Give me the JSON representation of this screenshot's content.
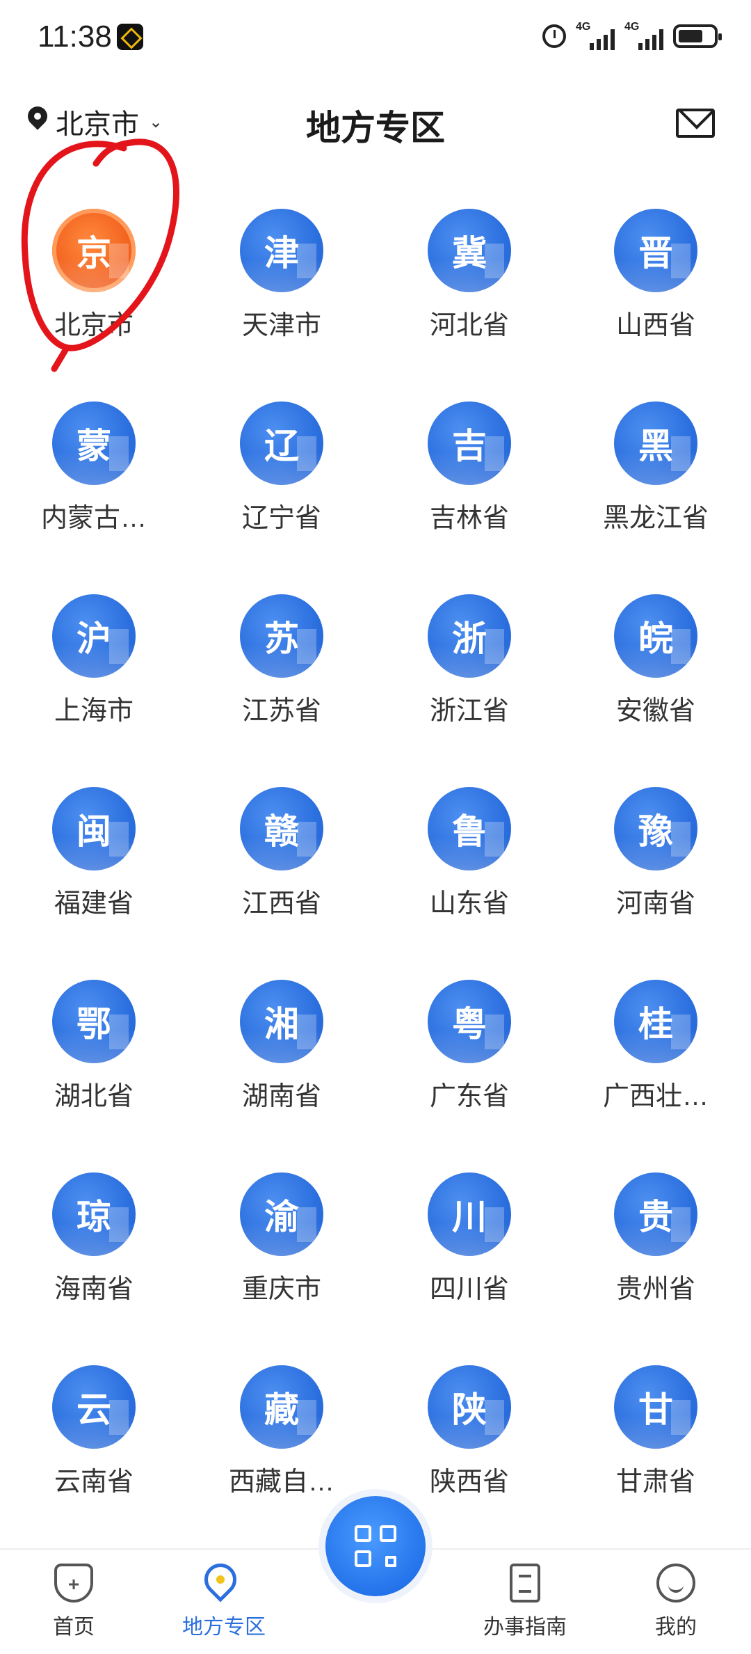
{
  "status_bar": {
    "time": "11:38",
    "network": "4G"
  },
  "header": {
    "location": "北京市",
    "title": "地方专区"
  },
  "regions": [
    {
      "glyph": "京",
      "label": "北京市",
      "style": "orange"
    },
    {
      "glyph": "津",
      "label": "天津市"
    },
    {
      "glyph": "冀",
      "label": "河北省"
    },
    {
      "glyph": "晋",
      "label": "山西省"
    },
    {
      "glyph": "蒙",
      "label": "内蒙古…"
    },
    {
      "glyph": "辽",
      "label": "辽宁省"
    },
    {
      "glyph": "吉",
      "label": "吉林省"
    },
    {
      "glyph": "黑",
      "label": "黑龙江省"
    },
    {
      "glyph": "沪",
      "label": "上海市"
    },
    {
      "glyph": "苏",
      "label": "江苏省"
    },
    {
      "glyph": "浙",
      "label": "浙江省"
    },
    {
      "glyph": "皖",
      "label": "安徽省"
    },
    {
      "glyph": "闽",
      "label": "福建省"
    },
    {
      "glyph": "赣",
      "label": "江西省"
    },
    {
      "glyph": "鲁",
      "label": "山东省"
    },
    {
      "glyph": "豫",
      "label": "河南省"
    },
    {
      "glyph": "鄂",
      "label": "湖北省"
    },
    {
      "glyph": "湘",
      "label": "湖南省"
    },
    {
      "glyph": "粤",
      "label": "广东省"
    },
    {
      "glyph": "桂",
      "label": "广西壮…"
    },
    {
      "glyph": "琼",
      "label": "海南省"
    },
    {
      "glyph": "渝",
      "label": "重庆市"
    },
    {
      "glyph": "川",
      "label": "四川省"
    },
    {
      "glyph": "贵",
      "label": "贵州省"
    },
    {
      "glyph": "云",
      "label": "云南省"
    },
    {
      "glyph": "藏",
      "label": "西藏自…"
    },
    {
      "glyph": "陕",
      "label": "陕西省"
    },
    {
      "glyph": "甘",
      "label": "甘肃省"
    }
  ],
  "bottom_nav": {
    "home": "首页",
    "local": "地方专区",
    "guide": "办事指南",
    "mine": "我的"
  },
  "colors": {
    "accent": "#2b6fdf",
    "highlight": "#e4141b",
    "featured": "#f05a1a"
  }
}
